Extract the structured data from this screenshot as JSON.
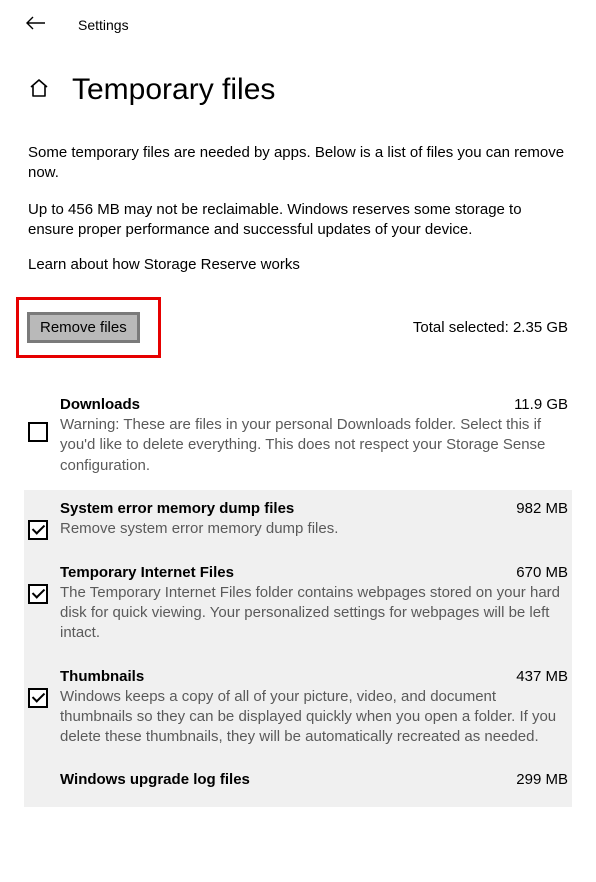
{
  "header": {
    "label": "Settings"
  },
  "page": {
    "title": "Temporary files"
  },
  "intro": {
    "p1": "Some temporary files are needed by apps. Below is a list of files you can remove now.",
    "p2": "Up to 456 MB may not be reclaimable. Windows reserves some storage to ensure proper performance and successful updates of your device.",
    "link": "Learn about how Storage Reserve works"
  },
  "action": {
    "remove_label": "Remove files",
    "total_label": "Total selected: 2.35 GB"
  },
  "items": [
    {
      "title": "Downloads",
      "size": "11.9 GB",
      "desc": "Warning: These are files in your personal Downloads folder. Select this if you'd like to delete everything. This does not respect your Storage Sense configuration.",
      "checked": false
    },
    {
      "title": "System error memory dump files",
      "size": "982 MB",
      "desc": "Remove system error memory dump files.",
      "checked": true
    },
    {
      "title": "Temporary Internet Files",
      "size": "670 MB",
      "desc": "The Temporary Internet Files folder contains webpages stored on your hard disk for quick viewing. Your personalized settings for webpages will be left intact.",
      "checked": true
    },
    {
      "title": "Thumbnails",
      "size": "437 MB",
      "desc": "Windows keeps a copy of all of your picture, video, and document thumbnails so they can be displayed quickly when you open a folder. If you delete these thumbnails, they will be automatically recreated as needed.",
      "checked": true
    },
    {
      "title": "Windows upgrade log files",
      "size": "299 MB",
      "desc": "",
      "checked": true
    }
  ]
}
